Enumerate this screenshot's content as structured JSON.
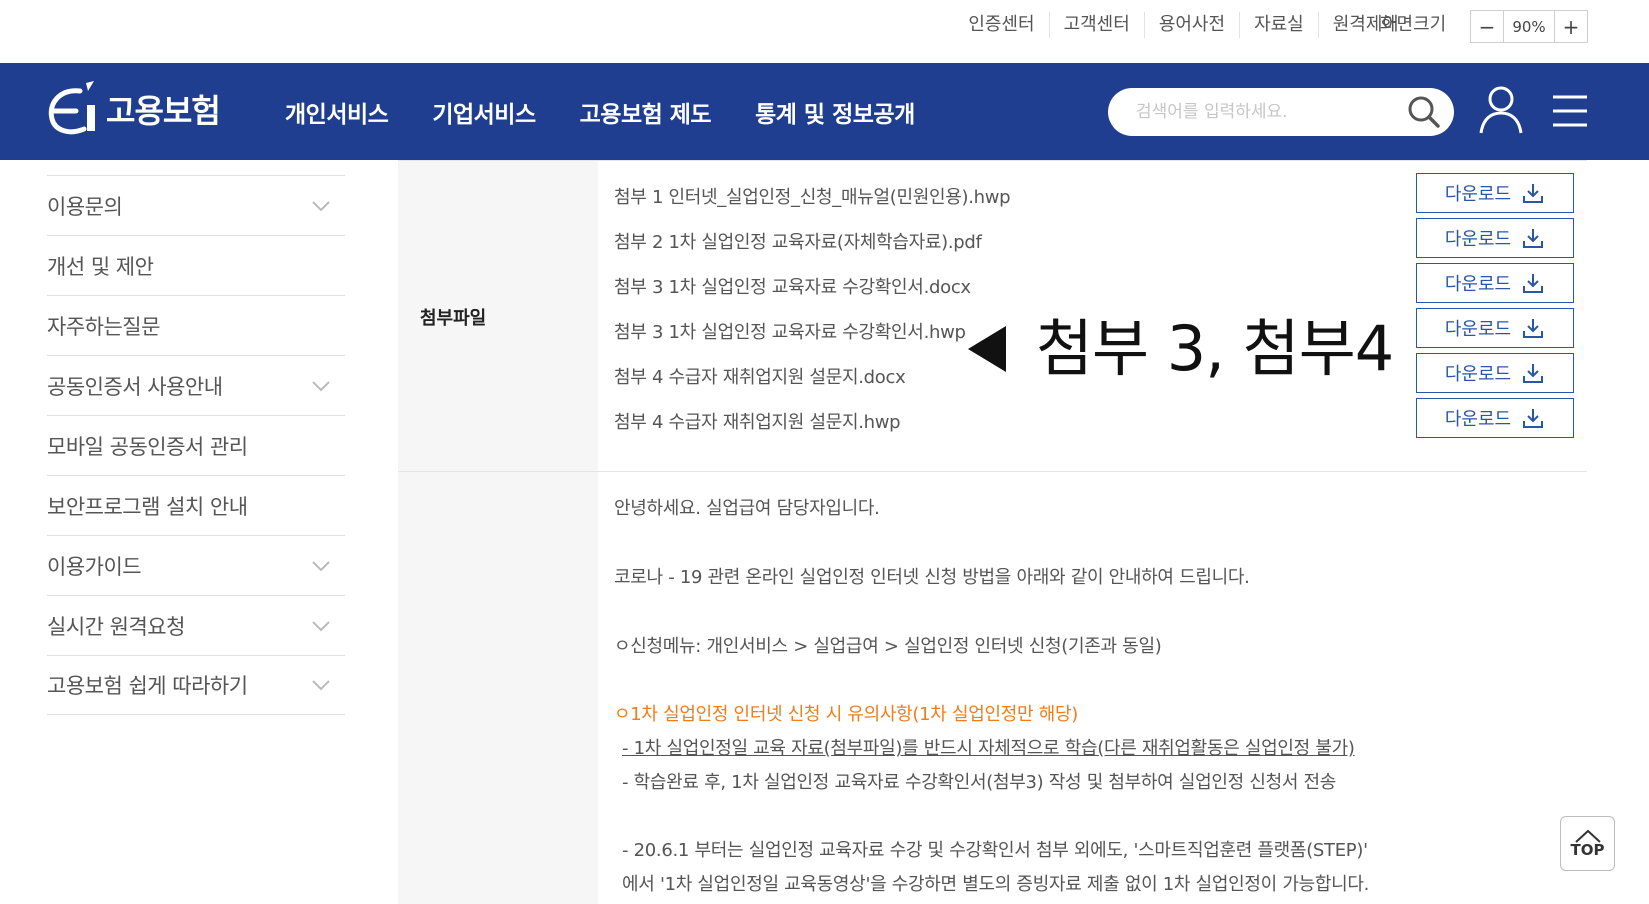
{
  "utility": {
    "links": [
      "인증센터",
      "고객센터",
      "용어사전",
      "자료실",
      "원격제어"
    ],
    "zoom_label": "화면크기",
    "zoom_minus": "−",
    "zoom_value": "90%",
    "zoom_plus": "+"
  },
  "header": {
    "logo_text": "고용보험",
    "nav": [
      "개인서비스",
      "기업서비스",
      "고용보험 제도",
      "통계 및 정보공개"
    ],
    "search_placeholder": "검색어를 입력하세요.",
    "brand_color": "#1f3e8f"
  },
  "sidebar": {
    "items": [
      {
        "label": "이용문의",
        "expandable": true
      },
      {
        "label": "개선 및 제안",
        "expandable": false
      },
      {
        "label": "자주하는질문",
        "expandable": false
      },
      {
        "label": "공동인증서 사용안내",
        "expandable": true
      },
      {
        "label": "모바일 공동인증서 관리",
        "expandable": false
      },
      {
        "label": "보안프로그램 설치 안내",
        "expandable": false
      },
      {
        "label": "이용가이드",
        "expandable": true
      },
      {
        "label": "실시간 원격요청",
        "expandable": true
      },
      {
        "label": "고용보험 쉽게 따라하기",
        "expandable": true
      }
    ]
  },
  "attachments": {
    "heading": "첨부파일",
    "download_label": "다운로드",
    "files": [
      "첨부 1 인터넷_실업인정_신청_매뉴얼(민원인용).hwp",
      "첨부 2 1차 실업인정 교육자료(자체학습자료).pdf",
      "첨부 3 1차 실업인정 교육자료 수강확인서.docx",
      "첨부 3 1차 실업인정 교육자료 수강확인서.hwp",
      "첨부 4 수급자 재취업지원 설문지.docx",
      "첨부 4 수급자 재취업지원 설문지.hwp"
    ]
  },
  "annotation": {
    "text": "첨부 3, 첨부4"
  },
  "body": {
    "lines": [
      {
        "text": "안녕하세요. 실업급여 담당자입니다.",
        "style": "normal"
      },
      {
        "text": "코로나 - 19 관련 온라인 실업인정 인터넷 신청 방법을 아래와 같이 안내하여 드립니다.",
        "style": "normal"
      },
      {
        "text": "ㅇ신청메뉴: 개인서비스 > 실업급여 > 실업인정 인터넷 신청(기존과 동일)",
        "style": "normal"
      },
      {
        "text": "ㅇ1차 실업인정 인터넷 신청 시 유의사항(1차 실업인정만 해당)",
        "style": "orange"
      },
      {
        "text": " - 1차 실업인정일 교육 자료(첨부파일)를 반드시 자체적으로 학습(다른 재취업활동은 실업인정 불가)",
        "style": "underline"
      },
      {
        "text": " - 학습완료 후, 1차 실업인정 교육자료 수강확인서(첨부3) 작성 및 첨부하여 실업인정 신청서 전송",
        "style": "normal"
      },
      {
        "text": " - 20.6.1 부터는 실업인정 교육자료 수강 및 수강확인서 첨부 외에도, '스마트직업훈련 플랫폼(STEP)'",
        "style": "normal"
      },
      {
        "text": "에서 '1차 실업인정일 교육동영상'을 수강하면 별도의 증빙자료 제출 없이 1차 실업인정이 가능합니다.",
        "style": "normal"
      }
    ]
  },
  "top_button": {
    "label": "TOP"
  }
}
